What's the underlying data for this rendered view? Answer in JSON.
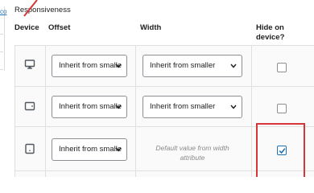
{
  "left_panel": {
    "cut_text": "co"
  },
  "section": {
    "title": "Responsiveness"
  },
  "table": {
    "headers": {
      "device": "Device",
      "offset": "Offset",
      "width": "Width",
      "hide_line1": "Hide on",
      "hide_line2": "device?"
    },
    "rows": [
      {
        "device_icon": "desktop-icon",
        "offset": "Inherit from smalle",
        "width": "Inherit from smaller",
        "hide": false
      },
      {
        "device_icon": "tablet-icon",
        "offset": "Inherit from smalle",
        "width": "Inherit from smaller",
        "hide": false
      },
      {
        "device_icon": "mobile-icon",
        "offset": "Inherit from smalle",
        "width_placeholder_line1": "Default value from width",
        "width_placeholder_line2": "attribute",
        "hide": true
      }
    ]
  },
  "colors": {
    "accent": "#2271b1",
    "highlight": "#d63638",
    "row_background": "#fafafa"
  }
}
